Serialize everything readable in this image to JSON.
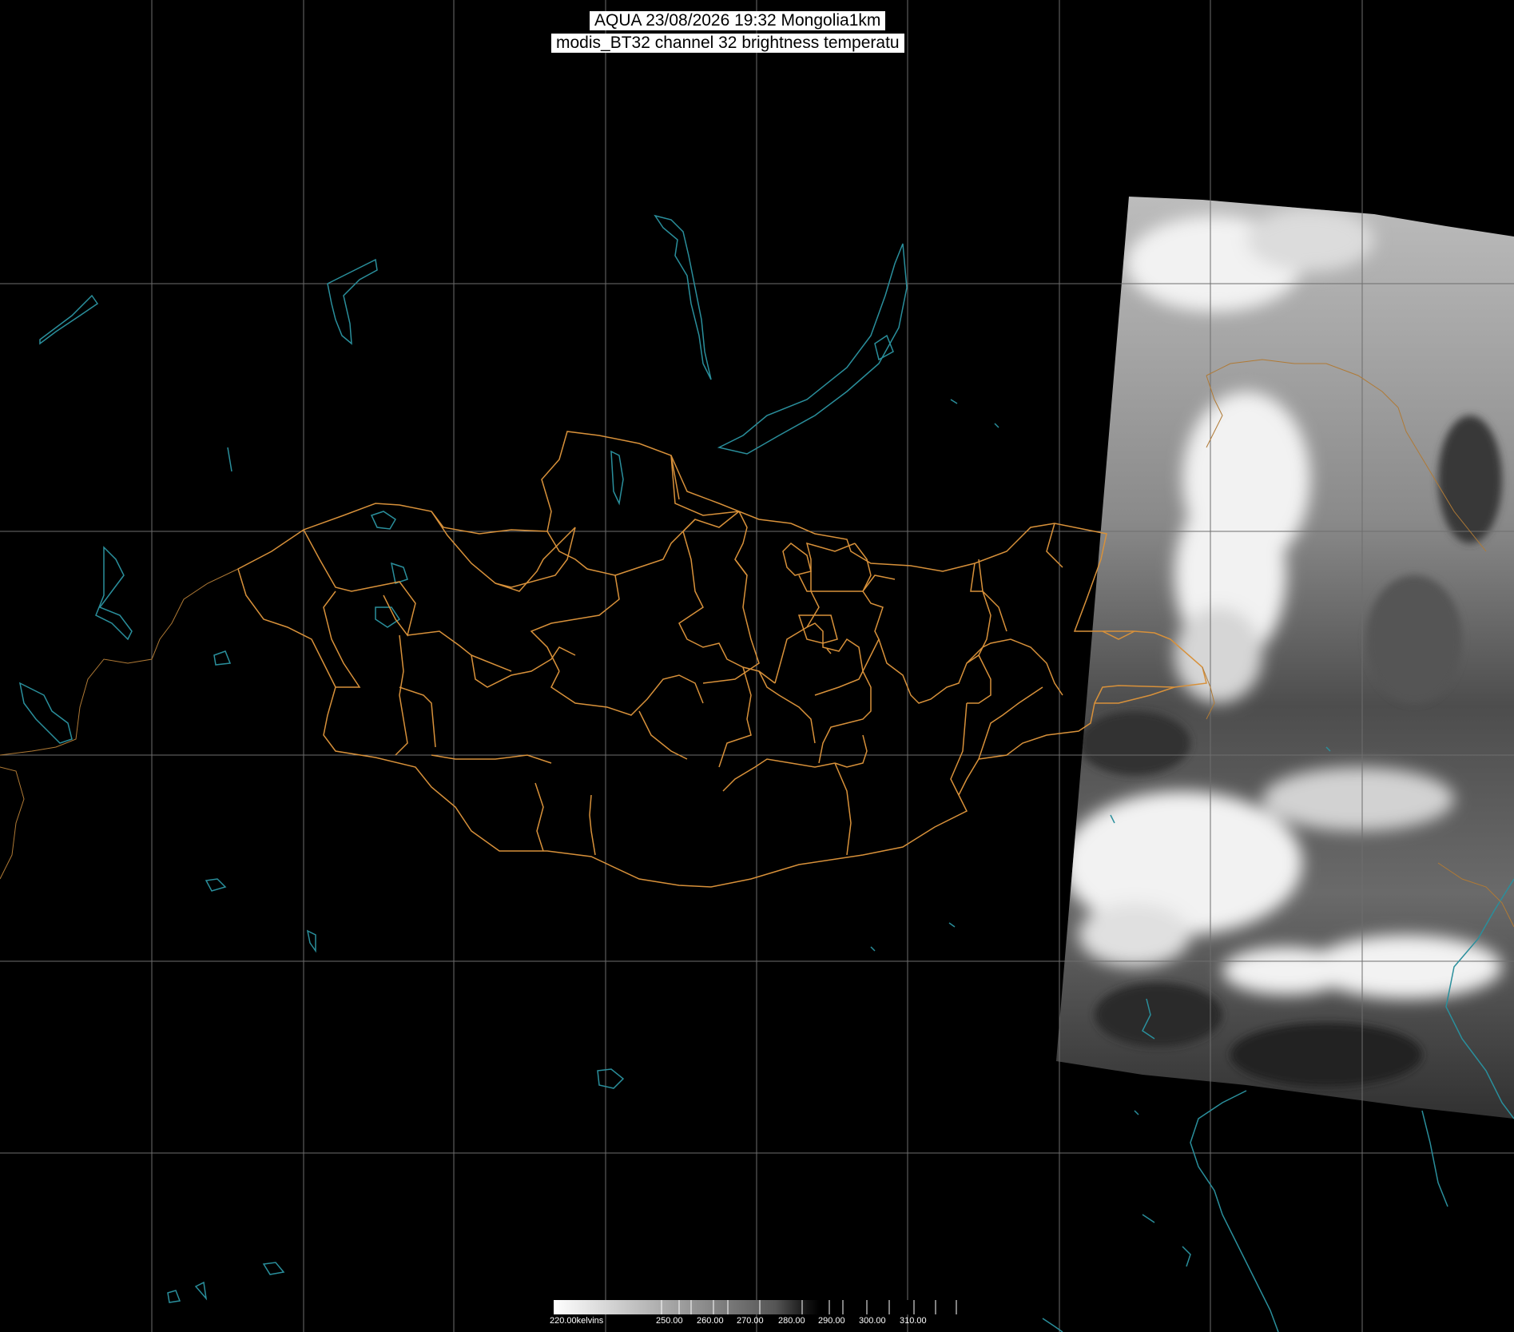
{
  "header": {
    "line1": "AQUA 23/08/2026 19:32 Mongolia1km",
    "line2": "modis_BT32 channel 32 brightness temperatu"
  },
  "colorbar": {
    "labels": [
      "220.00kelvins",
      "250.00",
      "260.00",
      "270.00",
      "280.00",
      "290.00",
      "300.00",
      "310.00"
    ]
  },
  "colors": {
    "border": "#d8913a",
    "coast": "#2a8f9c",
    "grid": "#6e6e6e"
  }
}
